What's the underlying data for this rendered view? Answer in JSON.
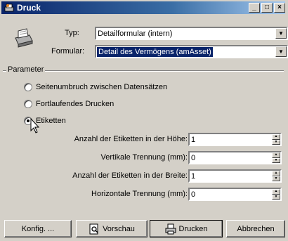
{
  "window": {
    "title": "Druck",
    "controls": [
      "_",
      "□",
      "×"
    ]
  },
  "header": {
    "typ_label": "Typ:",
    "typ_value": "Detailformular (intern)",
    "formular_label": "Formular:",
    "formular_value": "Detail des Vermögens (amAsset)"
  },
  "parameter": {
    "legend": "Parameter",
    "options": [
      {
        "label": "Seitenumbruch zwischen Datensätzen",
        "selected": false
      },
      {
        "label": "Fortlaufendes Drucken",
        "selected": false
      },
      {
        "label": "Etiketten",
        "selected": true
      }
    ],
    "fields": [
      {
        "label": "Anzahl der Etiketten in der Höhe:",
        "value": "1"
      },
      {
        "label": "Vertikale Trennung (mm):",
        "value": "0"
      },
      {
        "label": "Anzahl der Etiketten in der Breite:",
        "value": "1"
      },
      {
        "label": "Horizontale Trennung (mm):",
        "value": "0"
      }
    ]
  },
  "buttons": {
    "config": "Konfig. ...",
    "preview": "Vorschau",
    "print": "Drucken",
    "cancel": "Abbrechen"
  }
}
